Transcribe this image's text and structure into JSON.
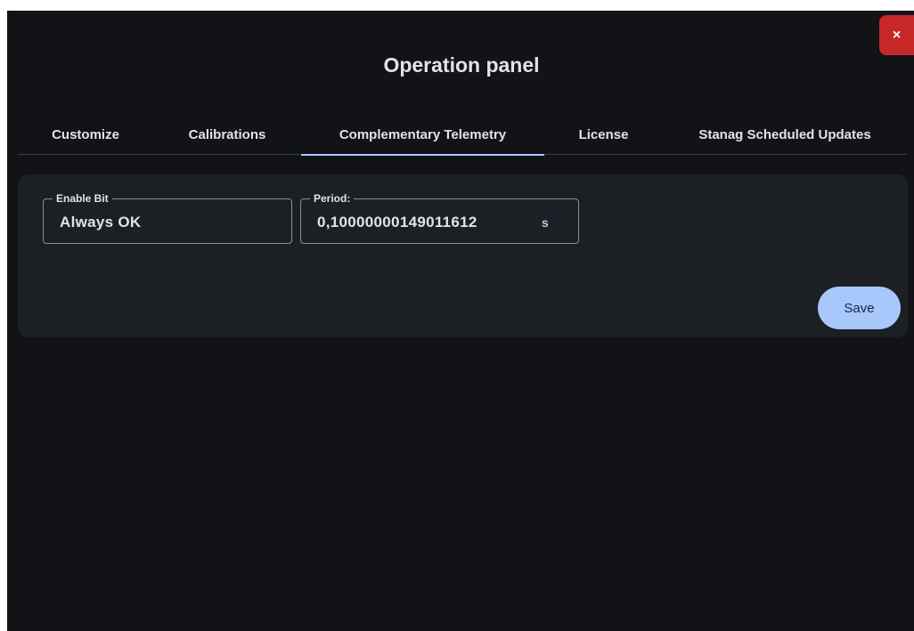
{
  "dialog": {
    "title": "Operation panel",
    "close_label": "×"
  },
  "tabs": [
    {
      "label": "Customize",
      "active": false
    },
    {
      "label": "Calibrations",
      "active": false
    },
    {
      "label": "Complementary Telemetry",
      "active": true
    },
    {
      "label": "License",
      "active": false
    },
    {
      "label": "Stanag Scheduled Updates",
      "active": false
    }
  ],
  "form": {
    "enable_bit": {
      "label": "Enable Bit",
      "value": "Always OK"
    },
    "period": {
      "label": "Period:",
      "value": "0,10000000149011612",
      "unit": "s"
    },
    "save_label": "Save"
  },
  "colors": {
    "background": "#111317",
    "card": "#1c1f24",
    "accent": "#a8c7fa",
    "close": "#c62828",
    "text": "#e3e3e6"
  }
}
